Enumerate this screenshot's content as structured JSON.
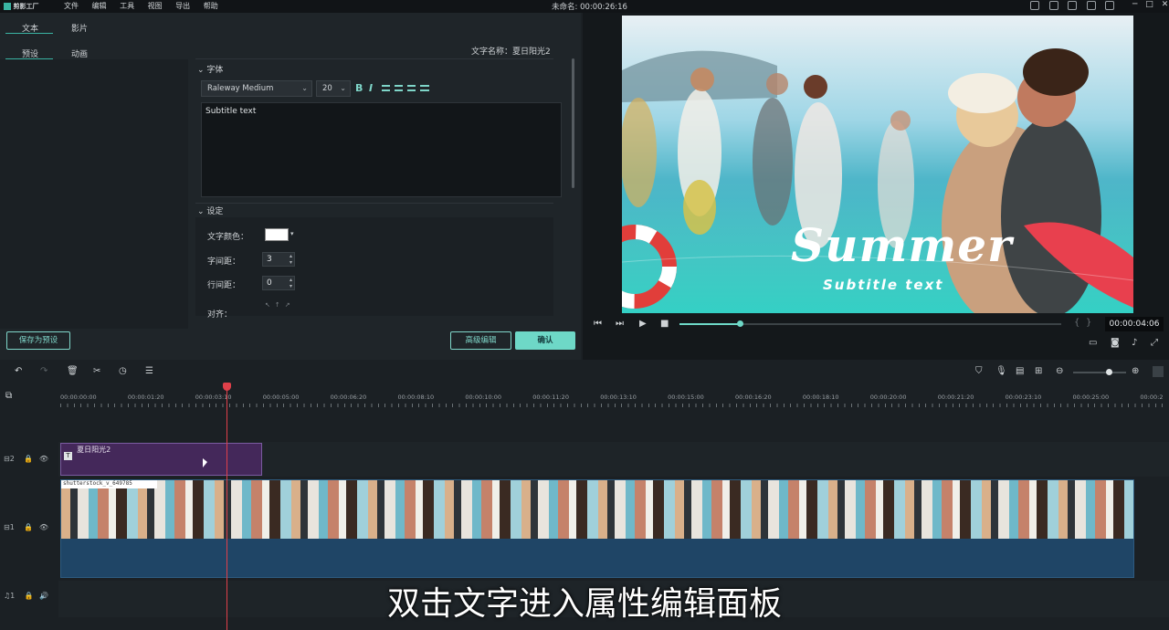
{
  "titlebar": {
    "logo": "剪影工厂",
    "menu": [
      "文件",
      "编辑",
      "工具",
      "视图",
      "导出",
      "帮助"
    ],
    "project": "未命名: 00:00:26:16"
  },
  "tabs": {
    "text": "文本",
    "video": "影片",
    "preset": "预设",
    "animation": "动画"
  },
  "text_name": "文字名称：夏日阳光2",
  "font_section": "字体",
  "font": {
    "family": "Raleway Medium",
    "size": "20",
    "bold": "B",
    "italic": "I"
  },
  "text_content": "Subtitle text",
  "settings_section": "设定",
  "settings": {
    "color_label": "文字颜色：",
    "letter_spacing_label": "字间距：",
    "letter_spacing_value": "3",
    "line_spacing_label": "行间距：",
    "line_spacing_value": "0",
    "align_label": "对齐："
  },
  "buttons": {
    "save_preset": "保存为预设",
    "advanced": "高级编辑",
    "confirm": "确认"
  },
  "preview": {
    "title": "Summer",
    "subtitle": "Subtitle text",
    "timecode": "00:00:04:06"
  },
  "ruler": [
    "00:00:00:00",
    "00:00:01:20",
    "00:00:03:10",
    "00:00:05:00",
    "00:00:06:20",
    "00:00:08:10",
    "00:00:10:00",
    "00:00:11:20",
    "00:00:13:10",
    "00:00:15:00",
    "00:00:16:20",
    "00:00:18:10",
    "00:00:20:00",
    "00:00:21:20",
    "00:00:23:10",
    "00:00:25:00",
    "00:00:2"
  ],
  "tracks": {
    "t2": "2",
    "t1": "1",
    "a1": "1",
    "title_clip": "夏日阳光2",
    "video_clip": "shutterstock_v_649785"
  },
  "caption": "双击文字进入属性编辑面板"
}
